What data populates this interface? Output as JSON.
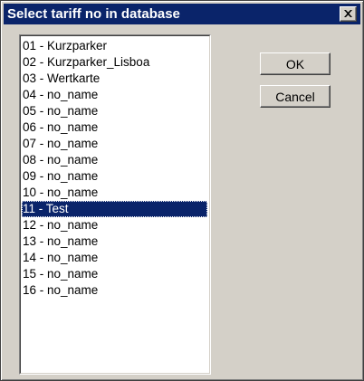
{
  "window": {
    "title": "Select tariff no in database",
    "close_icon": "close-icon"
  },
  "list": {
    "items": [
      "01 - Kurzparker",
      "02 - Kurzparker_Lisboa",
      "03 - Wertkarte",
      "04 - no_name",
      "05 - no_name",
      "06 - no_name",
      "07 - no_name",
      "08 - no_name",
      "09 - no_name",
      "10 - no_name",
      "11 - Test",
      "12 - no_name",
      "13 - no_name",
      "14 - no_name",
      "15 - no_name",
      "16 - no_name"
    ],
    "selected": "11 - Test"
  },
  "buttons": {
    "ok_label": "OK",
    "cancel_label": "Cancel"
  },
  "colors": {
    "title_bar": "#0a246a",
    "face": "#d4d0c8",
    "selection": "#0a246a"
  }
}
